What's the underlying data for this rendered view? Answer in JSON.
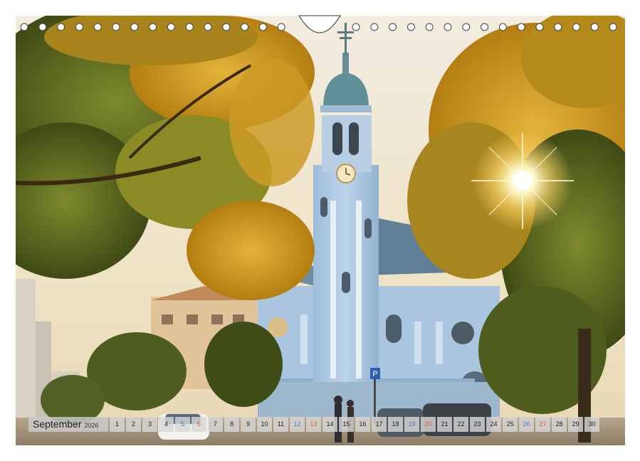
{
  "calendar": {
    "month": "September",
    "year": "2026",
    "days": [
      {
        "n": "1",
        "kind": "weekday"
      },
      {
        "n": "2",
        "kind": "weekday"
      },
      {
        "n": "3",
        "kind": "weekday"
      },
      {
        "n": "4",
        "kind": "weekday"
      },
      {
        "n": "5",
        "kind": "sat"
      },
      {
        "n": "6",
        "kind": "sun"
      },
      {
        "n": "7",
        "kind": "weekday"
      },
      {
        "n": "8",
        "kind": "weekday"
      },
      {
        "n": "9",
        "kind": "weekday"
      },
      {
        "n": "10",
        "kind": "weekday"
      },
      {
        "n": "11",
        "kind": "weekday"
      },
      {
        "n": "12",
        "kind": "sat"
      },
      {
        "n": "13",
        "kind": "sun"
      },
      {
        "n": "14",
        "kind": "weekday"
      },
      {
        "n": "15",
        "kind": "weekday"
      },
      {
        "n": "16",
        "kind": "weekday"
      },
      {
        "n": "17",
        "kind": "weekday"
      },
      {
        "n": "18",
        "kind": "weekday"
      },
      {
        "n": "19",
        "kind": "sat"
      },
      {
        "n": "20",
        "kind": "sun"
      },
      {
        "n": "21",
        "kind": "weekday"
      },
      {
        "n": "22",
        "kind": "weekday"
      },
      {
        "n": "23",
        "kind": "weekday"
      },
      {
        "n": "24",
        "kind": "weekday"
      },
      {
        "n": "25",
        "kind": "weekday"
      },
      {
        "n": "26",
        "kind": "sat"
      },
      {
        "n": "27",
        "kind": "sun"
      },
      {
        "n": "28",
        "kind": "weekday"
      },
      {
        "n": "29",
        "kind": "weekday"
      },
      {
        "n": "30",
        "kind": "weekday"
      }
    ]
  },
  "colors": {
    "sky": "#efe8d8",
    "church_blue": "#a8c4de",
    "roof_teal": "#5f8f99",
    "foliage_gold": "#d9a11f",
    "foliage_green": "#5e6a22",
    "saturday": "#4f74c6",
    "sunday": "#d2603a"
  },
  "sign": "P"
}
